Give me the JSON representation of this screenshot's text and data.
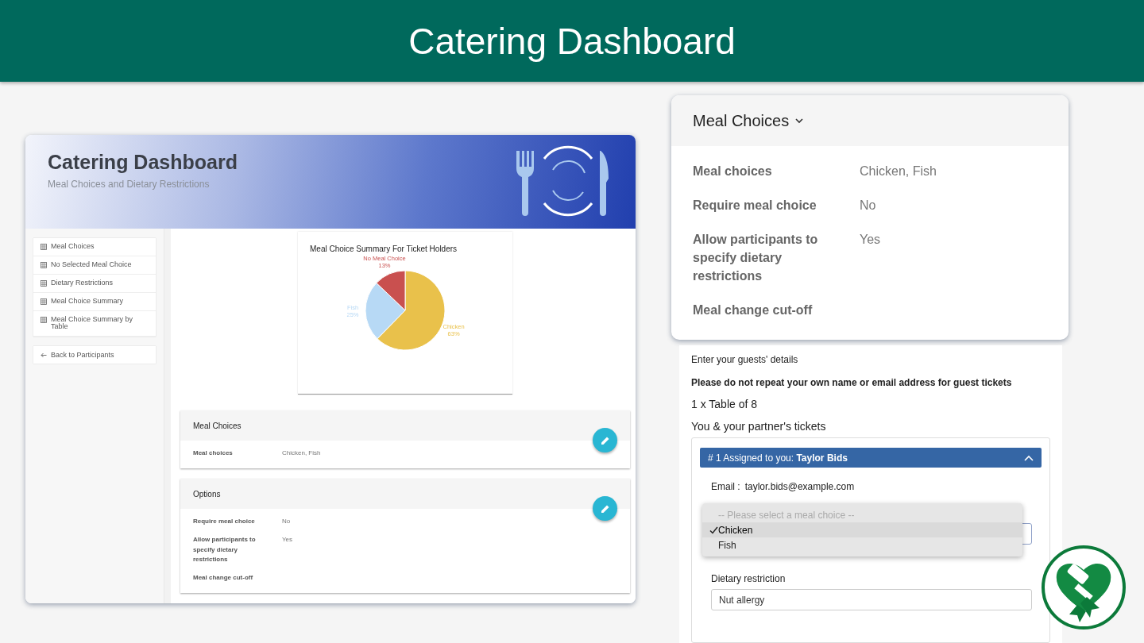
{
  "header": {
    "title": "Catering Dashboard"
  },
  "dashboard": {
    "title": "Catering Dashboard",
    "subtitle": "Meal Choices and Dietary Restrictions",
    "sidebar": {
      "items": [
        {
          "label": "Meal Choices"
        },
        {
          "label": "No Selected Meal Choice"
        },
        {
          "label": "Dietary Restrictions"
        },
        {
          "label": "Meal Choice Summary"
        },
        {
          "label": "Meal Choice Summary by Table"
        }
      ],
      "back_link": "Back to Participants"
    },
    "chart": {
      "chart_data": {
        "type": "pie",
        "title": "Meal Choice Summary For Ticket Holders",
        "categories": [
          "Chicken",
          "Fish",
          "No Meal Choice"
        ],
        "values": [
          63,
          25,
          13
        ],
        "value_labels": [
          "63%",
          "25%",
          "13%"
        ]
      }
    },
    "sections": [
      {
        "title": "Meal Choices",
        "rows": [
          {
            "label": "Meal choices",
            "value": "Chicken, Fish"
          }
        ]
      },
      {
        "title": "Options",
        "rows": [
          {
            "label": "Require meal choice",
            "value": "No"
          },
          {
            "label": "Allow participants to specify dietary restrictions",
            "value": "Yes"
          },
          {
            "label": "Meal change cut-off"
          }
        ]
      }
    ]
  },
  "settings_card": {
    "title": "Meal Choices",
    "rows": [
      {
        "label": "Meal choices",
        "value": "Chicken, Fish"
      },
      {
        "label": "Require meal choice",
        "value": "No"
      },
      {
        "label": "Allow participants to specify dietary restrictions",
        "value": "Yes"
      },
      {
        "label": "Meal change cut-off"
      }
    ]
  },
  "guest_form": {
    "intro": "Enter your guests' details",
    "warning": "Please do not repeat your own name or email address for guest tickets",
    "table_heading": "1 x Table of 8",
    "tickets_heading": "You & your partner's tickets",
    "ticket": {
      "title": "# 1 Assigned to you: **Taylor Bids**",
      "expanded": true,
      "email_label": "Email :",
      "email": "taylor.bids@example.com",
      "meal_options": [
        {
          "label": "-- Please select a meal choice --",
          "kind": "placeholder",
          "selected": false
        },
        {
          "label": "Chicken",
          "kind": "option",
          "selected": true
        },
        {
          "label": "Fish",
          "kind": "option",
          "selected": false
        }
      ],
      "dietary_label": "Dietary restriction",
      "dietary_value": "Nut allergy"
    }
  }
}
